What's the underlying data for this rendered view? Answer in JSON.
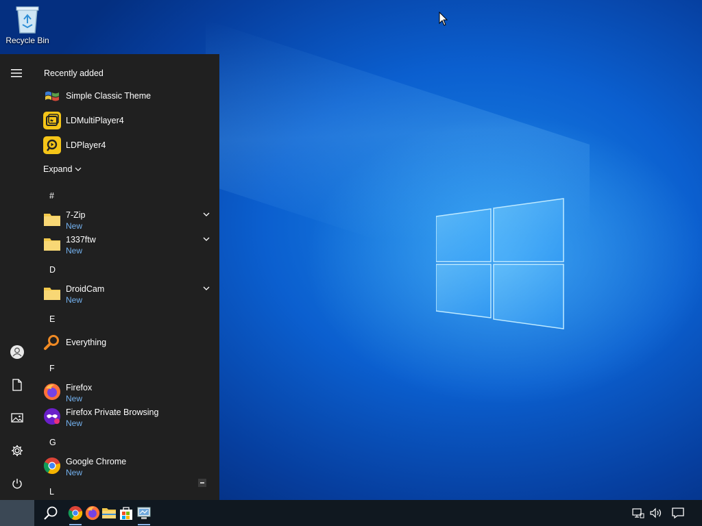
{
  "desktop": {
    "recycle_bin_label": "Recycle Bin"
  },
  "start_menu": {
    "recently_added_title": "Recently added",
    "recent_apps": [
      {
        "name": "Simple Classic Theme",
        "icon": "windows-flag-icon"
      },
      {
        "name": "LDMultiPlayer4",
        "icon": "ldmultiplayer-icon"
      },
      {
        "name": "LDPlayer4",
        "icon": "ldplayer-icon"
      }
    ],
    "expand_label": "Expand",
    "groups": [
      {
        "letter": "#",
        "apps": [
          {
            "name": "7-Zip",
            "sub": "New",
            "icon": "folder-icon",
            "expandable": true
          },
          {
            "name": "1337ftw",
            "sub": "New",
            "icon": "folder-icon",
            "expandable": true
          }
        ]
      },
      {
        "letter": "D",
        "apps": [
          {
            "name": "DroidCam",
            "sub": "New",
            "icon": "folder-icon",
            "expandable": true
          }
        ]
      },
      {
        "letter": "E",
        "apps": [
          {
            "name": "Everything",
            "icon": "magnifier-icon"
          }
        ]
      },
      {
        "letter": "F",
        "apps": [
          {
            "name": "Firefox",
            "sub": "New",
            "icon": "firefox-icon"
          },
          {
            "name": "Firefox Private Browsing",
            "sub": "New",
            "icon": "firefox-private-icon"
          }
        ]
      },
      {
        "letter": "G",
        "apps": [
          {
            "name": "Google Chrome",
            "sub": "New",
            "icon": "chrome-icon"
          }
        ]
      },
      {
        "letter": "L",
        "apps": []
      }
    ],
    "rail_icons": [
      "hamburger-icon",
      "user-icon",
      "documents-icon",
      "pictures-icon",
      "settings-icon",
      "power-icon"
    ]
  },
  "taskbar": {
    "items": [
      "start-button",
      "search-icon",
      "chrome-icon",
      "firefox-icon",
      "file-explorer-icon",
      "store-icon",
      "control-panel-icon"
    ],
    "tray": [
      "network-icon",
      "volume-icon",
      "notification-icon"
    ]
  },
  "colors": {
    "menu_bg": "#202020",
    "accent_sub": "#74b2f0",
    "taskbar_bg": "#101820",
    "wallpaper": "#0b5fcf"
  }
}
